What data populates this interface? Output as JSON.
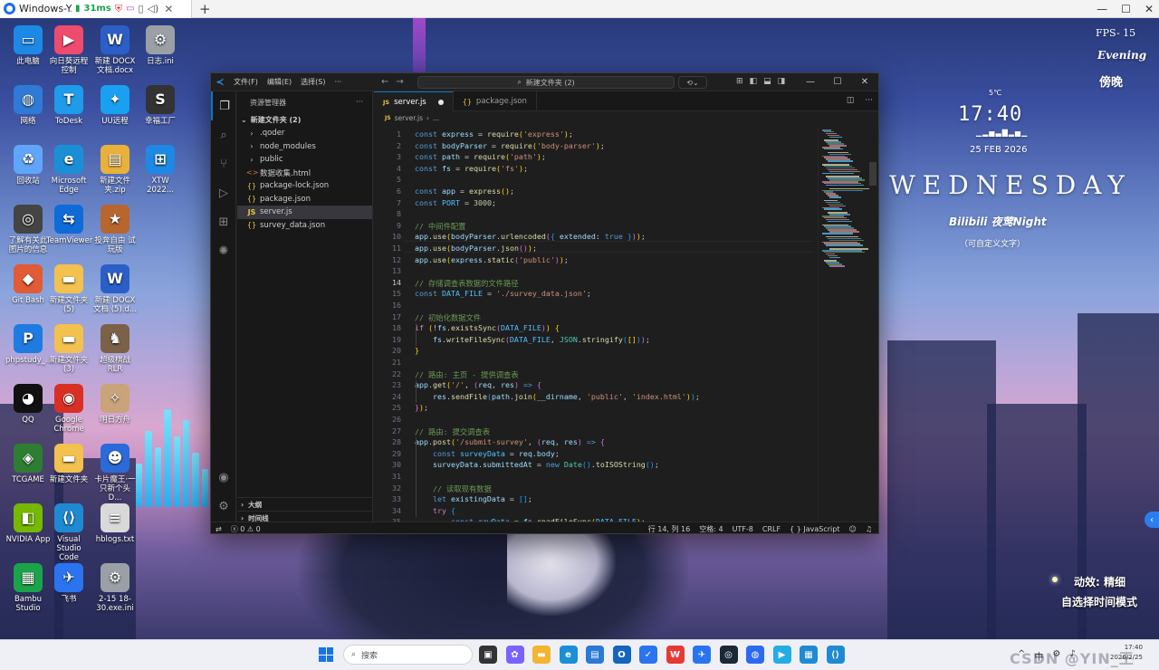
{
  "remote_bar": {
    "title": "Windows-Y...",
    "latency": "31ms",
    "tab_add": "+"
  },
  "desktop_icons": [
    {
      "label": "此电脑",
      "icon": "monitor-icon",
      "glyph": "▭",
      "color": "#1e88e5"
    },
    {
      "label": "向日葵远程控制",
      "icon": "sunflower-remote-icon",
      "glyph": "▶",
      "color": "#ef4b6c"
    },
    {
      "label": "新建 DOCX 文档.docx",
      "icon": "word-doc-icon",
      "glyph": "W",
      "color": "#2b5fc7"
    },
    {
      "label": "日志.ini",
      "icon": "ini-file-icon",
      "glyph": "⚙",
      "color": "#9aa0a6"
    },
    {
      "label": "网络",
      "icon": "network-icon",
      "glyph": "◍",
      "color": "#2f7ad6"
    },
    {
      "label": "ToDesk",
      "icon": "todesk-icon",
      "glyph": "T",
      "color": "#1e9be9"
    },
    {
      "label": "UU远程",
      "icon": "uu-remote-icon",
      "glyph": "✦",
      "color": "#1aa0f0"
    },
    {
      "label": "幸福工厂",
      "icon": "satisfactory-icon",
      "glyph": "S",
      "color": "#333333"
    },
    {
      "label": "回收站",
      "icon": "recycle-bin-icon",
      "glyph": "♻",
      "color": "#60a5fa"
    },
    {
      "label": "Microsoft Edge",
      "icon": "edge-icon",
      "glyph": "e",
      "color": "#1b8fd6"
    },
    {
      "label": "新建文件夹.zip",
      "icon": "zip-folder-icon",
      "glyph": "▤",
      "color": "#e8b23a"
    },
    {
      "label": "XTW 2022...",
      "icon": "xtw-icon",
      "glyph": "⊞",
      "color": "#1e88e5"
    },
    {
      "label": "了解有关此图片的信息",
      "icon": "spotlight-info-icon",
      "glyph": "◎",
      "color": "#444444"
    },
    {
      "label": "TeamViewer",
      "icon": "teamviewer-icon",
      "glyph": "⇆",
      "color": "#0e6bd8"
    },
    {
      "label": "投奔自由 试玩版",
      "icon": "game-demo-icon",
      "glyph": "★",
      "color": "#b8662f"
    },
    {
      "label": "Git Bash",
      "icon": "git-bash-icon",
      "glyph": "◆",
      "color": "#e15b34"
    },
    {
      "label": "新建文件夹 (5)",
      "icon": "folder-icon",
      "glyph": "▬",
      "color": "#f2c14e"
    },
    {
      "label": "新建 DOCX 文档 (5).d...",
      "icon": "word-doc-icon",
      "glyph": "W",
      "color": "#2b5fc7"
    },
    {
      "label": "phpstudy_...",
      "icon": "phpstudy-icon",
      "glyph": "P",
      "color": "#1f7be0"
    },
    {
      "label": "新建文件夹 (3)",
      "icon": "folder-icon",
      "glyph": "▬",
      "color": "#f2c14e"
    },
    {
      "label": "超级棋战 RLR",
      "icon": "game-icon",
      "glyph": "♞",
      "color": "#7a6148"
    },
    {
      "label": "QQ",
      "icon": "qq-icon",
      "glyph": "◕",
      "color": "#111111"
    },
    {
      "label": "Google Chrome",
      "icon": "chrome-icon",
      "glyph": "◉",
      "color": "#d93025"
    },
    {
      "label": "明日方舟",
      "icon": "arknights-icon",
      "glyph": "✧",
      "color": "#c9a37a"
    },
    {
      "label": "TCGAME",
      "icon": "tcgame-icon",
      "glyph": "◈",
      "color": "#2e7d32"
    },
    {
      "label": "新建文件夹",
      "icon": "folder-icon",
      "glyph": "▬",
      "color": "#f2c14e"
    },
    {
      "label": "卡片魔王·一只新个头 D...",
      "icon": "game-icon",
      "glyph": "☻",
      "color": "#2b6ad8"
    },
    {
      "label": "NVIDIA App",
      "icon": "nvidia-icon",
      "glyph": "◧",
      "color": "#76b900"
    },
    {
      "label": "Visual Studio Code",
      "icon": "vscode-icon",
      "glyph": "⟨⟩",
      "color": "#1f8ad2"
    },
    {
      "label": "hblogs.txt",
      "icon": "txt-file-icon",
      "glyph": "≡",
      "color": "#d9d9d9"
    },
    {
      "label": "Bambu Studio",
      "icon": "bambu-studio-icon",
      "glyph": "▦",
      "color": "#1aa34a"
    },
    {
      "label": "飞书",
      "icon": "feishu-icon",
      "glyph": "✈",
      "color": "#2a74f0"
    },
    {
      "label": "2-15 18-30.exe.ini",
      "icon": "ini-file-icon",
      "glyph": "⚙",
      "color": "#9aa0a6"
    }
  ],
  "widget": {
    "fps": "FPS- 15",
    "evening": "Evening",
    "bangwan": "傍晚",
    "small": "5℃",
    "time": "17:40",
    "eq": "▁▂▅▃▇▂▅▁",
    "date": "25 FEB 2026",
    "weekday": "WEDNESDAY",
    "song": "Bilibili 夜莺Night",
    "edit_hint": "（可自定义文字）",
    "anim": "动效: 精细",
    "mode": "自选择时间模式"
  },
  "vscode": {
    "menus": [
      "文件(F)",
      "编辑(E)",
      "选择(S)",
      "···"
    ],
    "command_center": "新建文件夹 (2)",
    "explorer_title": "资源管理器",
    "explorer_more": "···",
    "workspace_root": "新建文件夹 (2)",
    "tree": [
      {
        "label": ".qoder",
        "type": "folder",
        "glyph": "›"
      },
      {
        "label": "node_modules",
        "type": "folder",
        "glyph": "›"
      },
      {
        "label": "public",
        "type": "folder",
        "glyph": "›"
      },
      {
        "label": "数据收集.html",
        "type": "html",
        "glyph": "<>"
      },
      {
        "label": "package-lock.json",
        "type": "json",
        "glyph": "{}"
      },
      {
        "label": "package.json",
        "type": "json",
        "glyph": "{}"
      },
      {
        "label": "server.js",
        "type": "js",
        "glyph": "JS",
        "selected": true
      },
      {
        "label": "survey_data.json",
        "type": "json",
        "glyph": "{}"
      }
    ],
    "outline": "大纲",
    "timeline": "时间线",
    "tabs": [
      {
        "label": "server.js",
        "icon": "JS",
        "active": true,
        "dirty": true
      },
      {
        "label": "package.json",
        "icon": "{}",
        "active": false,
        "dirty": false
      }
    ],
    "breadcrumb": [
      "server.js",
      "..."
    ],
    "current_line": 14,
    "code": [
      [
        [
          "k",
          "const "
        ],
        [
          "v",
          "express"
        ],
        [
          "p",
          " = "
        ],
        [
          "f",
          "require"
        ],
        [
          "b1",
          "("
        ],
        [
          "s",
          "'express'"
        ],
        [
          "b1",
          ")"
        ],
        [
          "p",
          ";"
        ]
      ],
      [
        [
          "k",
          "const "
        ],
        [
          "v",
          "bodyParser"
        ],
        [
          "p",
          " = "
        ],
        [
          "f",
          "require"
        ],
        [
          "b1",
          "("
        ],
        [
          "s",
          "'body-parser'"
        ],
        [
          "b1",
          ")"
        ],
        [
          "p",
          ";"
        ]
      ],
      [
        [
          "k",
          "const "
        ],
        [
          "v",
          "path"
        ],
        [
          "p",
          " = "
        ],
        [
          "f",
          "require"
        ],
        [
          "b1",
          "("
        ],
        [
          "s",
          "'path'"
        ],
        [
          "b1",
          ")"
        ],
        [
          "p",
          ";"
        ]
      ],
      [
        [
          "k",
          "const "
        ],
        [
          "v",
          "fs"
        ],
        [
          "p",
          " = "
        ],
        [
          "f",
          "require"
        ],
        [
          "b1",
          "("
        ],
        [
          "s",
          "'fs'"
        ],
        [
          "b1",
          ")"
        ],
        [
          "p",
          ";"
        ]
      ],
      [],
      [
        [
          "k",
          "const "
        ],
        [
          "v",
          "app"
        ],
        [
          "p",
          " = "
        ],
        [
          "f",
          "express"
        ],
        [
          "b1",
          "()"
        ],
        [
          "p",
          ";"
        ]
      ],
      [
        [
          "k",
          "const "
        ],
        [
          "c",
          "PORT"
        ],
        [
          "p",
          " = "
        ],
        [
          "n",
          "3000"
        ],
        [
          "p",
          ";"
        ]
      ],
      [],
      [
        [
          "cm",
          "// 中间件配置"
        ]
      ],
      [
        [
          "v",
          "app"
        ],
        [
          "p",
          "."
        ],
        [
          "f",
          "use"
        ],
        [
          "b1",
          "("
        ],
        [
          "v",
          "bodyParser"
        ],
        [
          "p",
          "."
        ],
        [
          "f",
          "urlencoded"
        ],
        [
          "b2",
          "("
        ],
        [
          "b3",
          "{ "
        ],
        [
          "v",
          "extended"
        ],
        [
          "p",
          ": "
        ],
        [
          "k",
          "true"
        ],
        [
          "b3",
          " }"
        ],
        [
          "b2",
          ")"
        ],
        [
          "b1",
          ")"
        ],
        [
          "p",
          ";"
        ]
      ],
      [
        [
          "v",
          "app"
        ],
        [
          "p",
          "."
        ],
        [
          "f",
          "use"
        ],
        [
          "b1",
          "("
        ],
        [
          "v",
          "bodyParser"
        ],
        [
          "p",
          "."
        ],
        [
          "f",
          "json"
        ],
        [
          "b2",
          "()"
        ],
        [
          "b1",
          ")"
        ],
        [
          "p",
          ";"
        ]
      ],
      [
        [
          "v",
          "app"
        ],
        [
          "p",
          "."
        ],
        [
          "f",
          "use"
        ],
        [
          "b1",
          "("
        ],
        [
          "v",
          "express"
        ],
        [
          "p",
          "."
        ],
        [
          "f",
          "static"
        ],
        [
          "b2",
          "("
        ],
        [
          "s",
          "'public'"
        ],
        [
          "b2",
          ")"
        ],
        [
          "b1",
          ")"
        ],
        [
          "p",
          ";"
        ]
      ],
      [],
      [
        [
          "cm",
          "// 存储调查表数据的文件路径"
        ]
      ],
      [
        [
          "k",
          "const "
        ],
        [
          "c",
          "DATA_FILE"
        ],
        [
          "p",
          " = "
        ],
        [
          "s",
          "'./survey_data.json'"
        ],
        [
          "p",
          ";"
        ]
      ],
      [],
      [
        [
          "cm",
          "// 初始化数据文件"
        ]
      ],
      [
        [
          "kw",
          "if "
        ],
        [
          "b1",
          "("
        ],
        [
          "p",
          "!"
        ],
        [
          "v",
          "fs"
        ],
        [
          "p",
          "."
        ],
        [
          "f",
          "existsSync"
        ],
        [
          "b2",
          "("
        ],
        [
          "c",
          "DATA_FILE"
        ],
        [
          "b2",
          ")"
        ],
        [
          "b1",
          ")"
        ],
        [
          "p",
          " "
        ],
        [
          "b1",
          "{"
        ]
      ],
      [
        [
          "p",
          "    "
        ],
        [
          "v",
          "fs"
        ],
        [
          "p",
          "."
        ],
        [
          "f",
          "writeFileSync"
        ],
        [
          "b2",
          "("
        ],
        [
          "c",
          "DATA_FILE"
        ],
        [
          "p",
          ", "
        ],
        [
          "cl",
          "JSON"
        ],
        [
          "p",
          "."
        ],
        [
          "f",
          "stringify"
        ],
        [
          "b3",
          "("
        ],
        [
          "b1",
          "[]"
        ],
        [
          "b3",
          ")"
        ],
        [
          "b2",
          ")"
        ],
        [
          "p",
          ";"
        ]
      ],
      [
        [
          "b1",
          "}"
        ]
      ],
      [],
      [
        [
          "cm",
          "// 路由: 主页 - 提供调查表"
        ]
      ],
      [
        [
          "v",
          "app"
        ],
        [
          "p",
          "."
        ],
        [
          "f",
          "get"
        ],
        [
          "b1",
          "("
        ],
        [
          "s",
          "'/'"
        ],
        [
          "p",
          ", "
        ],
        [
          "b2",
          "("
        ],
        [
          "v",
          "req"
        ],
        [
          "p",
          ", "
        ],
        [
          "v",
          "res"
        ],
        [
          "b2",
          ")"
        ],
        [
          "p",
          " "
        ],
        [
          "k",
          "=>"
        ],
        [
          "p",
          " "
        ],
        [
          "b2",
          "{"
        ]
      ],
      [
        [
          "p",
          "    "
        ],
        [
          "v",
          "res"
        ],
        [
          "p",
          "."
        ],
        [
          "f",
          "sendFile"
        ],
        [
          "b3",
          "("
        ],
        [
          "v",
          "path"
        ],
        [
          "p",
          "."
        ],
        [
          "f",
          "join"
        ],
        [
          "b1",
          "("
        ],
        [
          "v",
          "__dirname"
        ],
        [
          "p",
          ", "
        ],
        [
          "s",
          "'public'"
        ],
        [
          "p",
          ", "
        ],
        [
          "s",
          "'index.html'"
        ],
        [
          "b1",
          ")"
        ],
        [
          "b3",
          ")"
        ],
        [
          "p",
          ";"
        ]
      ],
      [
        [
          "b2",
          "}"
        ],
        [
          "b1",
          ")"
        ],
        [
          "p",
          ";"
        ]
      ],
      [],
      [
        [
          "cm",
          "// 路由: 提交调查表"
        ]
      ],
      [
        [
          "v",
          "app"
        ],
        [
          "p",
          "."
        ],
        [
          "f",
          "post"
        ],
        [
          "b1",
          "("
        ],
        [
          "s",
          "'/submit-survey'"
        ],
        [
          "p",
          ", "
        ],
        [
          "b2",
          "("
        ],
        [
          "v",
          "req"
        ],
        [
          "p",
          ", "
        ],
        [
          "v",
          "res"
        ],
        [
          "b2",
          ")"
        ],
        [
          "p",
          " "
        ],
        [
          "k",
          "=>"
        ],
        [
          "p",
          " "
        ],
        [
          "b2",
          "{"
        ]
      ],
      [
        [
          "p",
          "    "
        ],
        [
          "k",
          "const "
        ],
        [
          "c",
          "surveyData"
        ],
        [
          "p",
          " = "
        ],
        [
          "v",
          "req"
        ],
        [
          "p",
          "."
        ],
        [
          "v",
          "body"
        ],
        [
          "p",
          ";"
        ]
      ],
      [
        [
          "p",
          "    "
        ],
        [
          "v",
          "surveyData"
        ],
        [
          "p",
          "."
        ],
        [
          "v",
          "submittedAt"
        ],
        [
          "p",
          " = "
        ],
        [
          "k",
          "new "
        ],
        [
          "cl",
          "Date"
        ],
        [
          "b3",
          "()"
        ],
        [
          "p",
          "."
        ],
        [
          "f",
          "toISOString"
        ],
        [
          "b3",
          "()"
        ],
        [
          "p",
          ";"
        ]
      ],
      [],
      [
        [
          "p",
          "    "
        ],
        [
          "cm",
          "// 读取现有数据"
        ]
      ],
      [
        [
          "p",
          "    "
        ],
        [
          "k",
          "let "
        ],
        [
          "v",
          "existingData"
        ],
        [
          "p",
          " = "
        ],
        [
          "b3",
          "[]"
        ],
        [
          "p",
          ";"
        ]
      ],
      [
        [
          "p",
          "    "
        ],
        [
          "kw",
          "try "
        ],
        [
          "b3",
          "{"
        ]
      ],
      [
        [
          "p",
          "        "
        ],
        [
          "k",
          "const "
        ],
        [
          "c",
          "rawData"
        ],
        [
          "p",
          " = "
        ],
        [
          "v",
          "fs"
        ],
        [
          "p",
          "."
        ],
        [
          "f",
          "readFileSync"
        ],
        [
          "b1",
          "("
        ],
        [
          "c",
          "DATA_FILE"
        ],
        [
          "b1",
          ")"
        ],
        [
          "p",
          ";"
        ]
      ]
    ],
    "status": {
      "errors": "0",
      "warnings": "0",
      "position": "行 14, 列 16",
      "spaces": "空格: 4",
      "encoding": "UTF-8",
      "eol": "CRLF",
      "language": "JavaScript",
      "braces": "{ }"
    }
  },
  "taskbar": {
    "search_placeholder": "搜索",
    "apps": [
      {
        "name": "task-view",
        "glyph": "▣",
        "color": "#333333"
      },
      {
        "name": "copilot",
        "glyph": "✿",
        "color": "#7b61ff"
      },
      {
        "name": "file-explorer",
        "glyph": "▬",
        "color": "#f2b632"
      },
      {
        "name": "edge",
        "glyph": "e",
        "color": "#1b8fd6"
      },
      {
        "name": "store",
        "glyph": "▤",
        "color": "#2a7ad6"
      },
      {
        "name": "outlook",
        "glyph": "O",
        "color": "#1565c0"
      },
      {
        "name": "todo",
        "glyph": "✓",
        "color": "#2a74f0"
      },
      {
        "name": "wps",
        "glyph": "W",
        "color": "#e53935"
      },
      {
        "name": "feishu",
        "glyph": "✈",
        "color": "#2a74f0"
      },
      {
        "name": "steam",
        "glyph": "◎",
        "color": "#1b2838"
      },
      {
        "name": "browser",
        "glyph": "◍",
        "color": "#2d69f0"
      },
      {
        "name": "bilibili",
        "glyph": "▶",
        "color": "#23ade5"
      },
      {
        "name": "display",
        "glyph": "▦",
        "color": "#1f8ad2"
      },
      {
        "name": "vscode",
        "glyph": "⟨⟩",
        "color": "#1f8ad2"
      }
    ],
    "tray": [
      "^",
      "中",
      "⚙",
      "♪"
    ],
    "clock_time": "17:40",
    "clock_date": "2026/2/25",
    "watermark": "CSDN @YIN_王"
  }
}
